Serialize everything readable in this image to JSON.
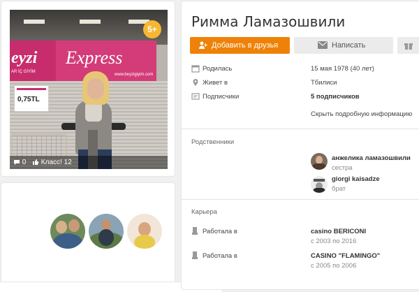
{
  "profile": {
    "name": "Римма Ламазошвили"
  },
  "photo": {
    "badge": "5+",
    "comments_count": "0",
    "class_label": "Класс!",
    "class_count": "12",
    "sign_brand_left": "eyzi",
    "sign_brand_left_sub": "AR İÇ GİYİM",
    "sign_brand_right": "Express",
    "sign_brand_right_sub": "www.beyzigiyim.com",
    "price_tag": "0,75TL"
  },
  "actions": {
    "add_friend_label": "Добавить в друзья",
    "write_label": "Написать"
  },
  "info": [
    {
      "label": "Родилась",
      "value": "15 мая 1978 (40 лет)",
      "icon": "calendar-icon"
    },
    {
      "label": "Живет в",
      "value": "Тбилиси",
      "icon": "location-icon"
    },
    {
      "label": "Подписчики",
      "value": "5 подписчиков",
      "icon": "subscribers-icon"
    }
  ],
  "show_more_label": "Скрыть подробную информацию",
  "relatives": {
    "title": "Родственники",
    "items": [
      {
        "name": "анжелика ламазошвили",
        "relation": "сестра"
      },
      {
        "name": "giorgi kaisadze",
        "relation": "брат"
      }
    ]
  },
  "career": {
    "title": "Карьера",
    "items": [
      {
        "label": "Работала в",
        "company": "casino BERICONI",
        "years": "с 2003 по 2016"
      },
      {
        "label": "Работала в",
        "company": "CASINO \"FLAMINGO\"",
        "years": "с 2005 по 2006"
      }
    ]
  },
  "colors": {
    "accent": "#ee8208",
    "badge": "#f7b733",
    "page_bg": "#f0f0f0"
  }
}
